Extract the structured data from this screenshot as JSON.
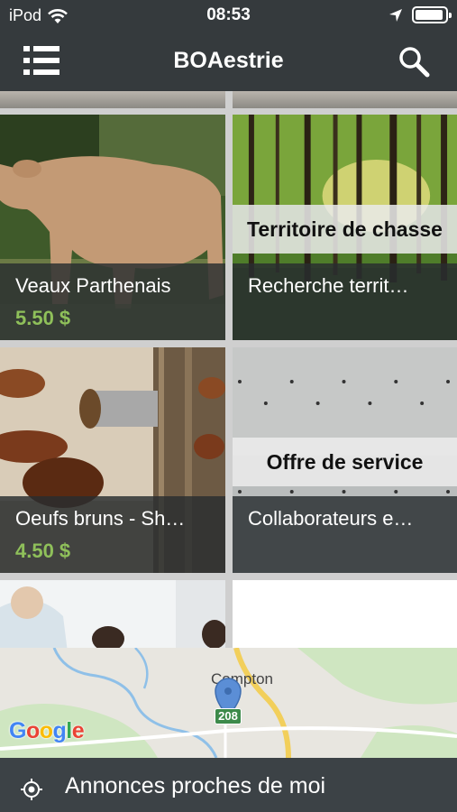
{
  "status_bar": {
    "carrier": "iPod",
    "time": "08:53"
  },
  "app_bar": {
    "title": "BOAestrie"
  },
  "listings": [
    {
      "title": "Veaux Parthenais",
      "price": "5.50 $",
      "category": ""
    },
    {
      "title": "Recherche territ…",
      "price": "",
      "category": "Territoire de chasse"
    },
    {
      "title": "Oeufs bruns - Sh…",
      "price": "4.50 $",
      "category": ""
    },
    {
      "title": "Collaborateurs e…",
      "price": "",
      "category": "Offre de service"
    }
  ],
  "map": {
    "town": "Compton",
    "route_number": "208",
    "attribution": "Google"
  },
  "bottom_bar": {
    "label": "Annonces proches de moi"
  },
  "colors": {
    "bar_dark": "#353a3d",
    "price_green": "#8fc05a",
    "map_pin": "#5b8ed6"
  }
}
